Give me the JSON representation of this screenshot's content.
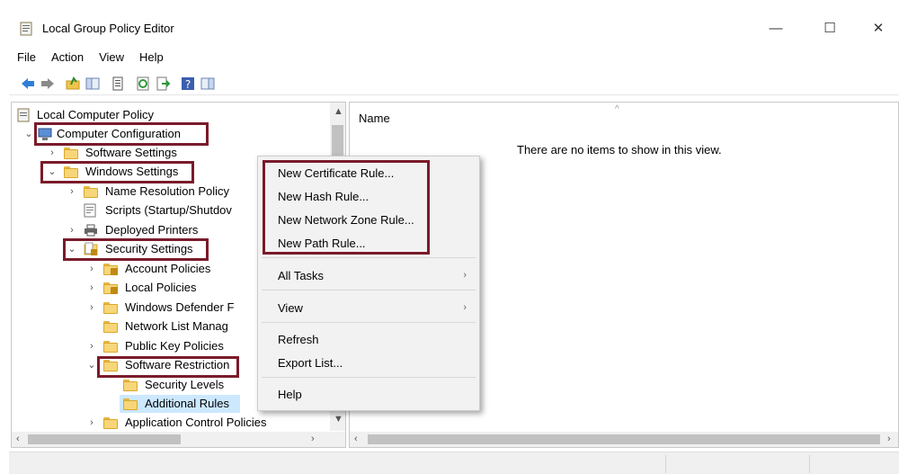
{
  "window": {
    "title": "Local Group Policy Editor",
    "min": "—",
    "max": "☐",
    "close": "✕"
  },
  "menu": [
    "File",
    "Action",
    "View",
    "Help"
  ],
  "tree": {
    "root": "Local Computer Policy",
    "computer_config": "Computer Configuration",
    "software_settings": "Software Settings",
    "windows_settings": "Windows Settings",
    "name_resolution": "Name Resolution Policy",
    "scripts": "Scripts (Startup/Shutdov",
    "printers": "Deployed Printers",
    "security_settings": "Security Settings",
    "account_policies": "Account Policies",
    "local_policies": "Local Policies",
    "defender": "Windows Defender F",
    "network_list": "Network List Manag",
    "public_key": "Public Key Policies",
    "software_restriction": "Software Restriction",
    "security_levels": "Security Levels",
    "additional_rules": "Additional Rules",
    "app_control": "Application Control Policies"
  },
  "right_pane": {
    "column_header": "Name",
    "empty_message": "There are no items to show in this view."
  },
  "context_menu": {
    "new_certificate_rule": "New Certificate Rule...",
    "new_hash_rule": "New Hash Rule...",
    "new_network_zone_rule": "New Network Zone Rule...",
    "new_path_rule": "New Path Rule...",
    "all_tasks": "All Tasks",
    "view": "View",
    "refresh": "Refresh",
    "export_list": "Export List...",
    "help": "Help"
  },
  "colors": {
    "highlight_box": "#7a1b2a",
    "selection": "#cce8ff"
  }
}
